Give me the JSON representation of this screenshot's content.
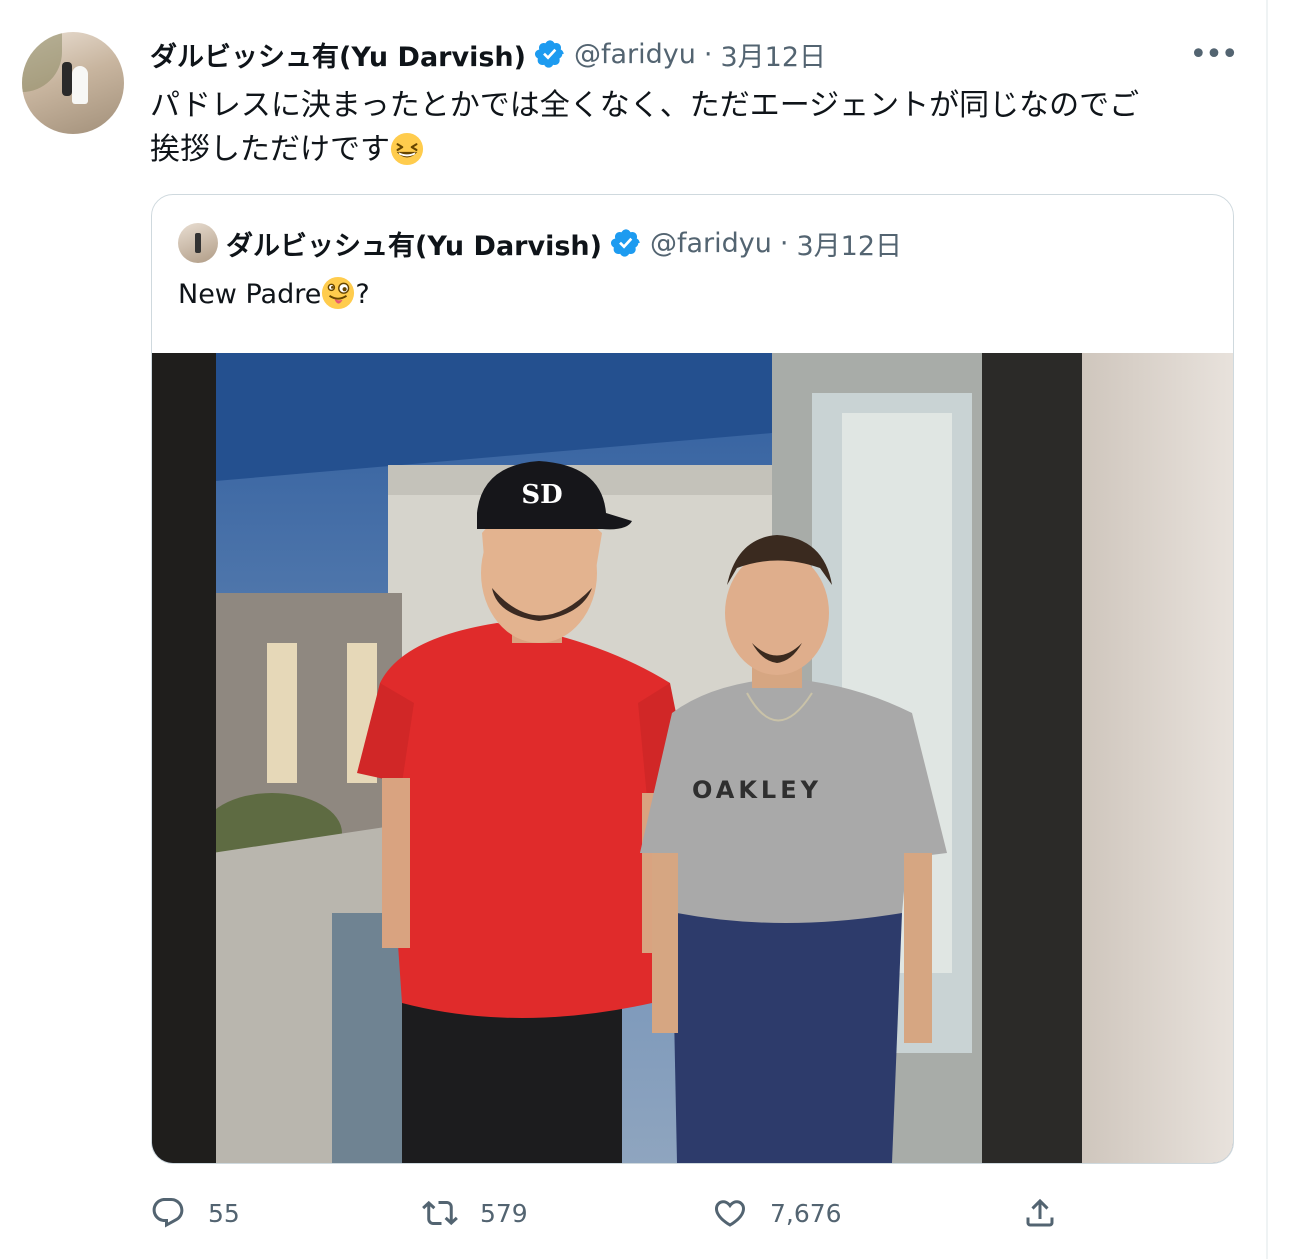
{
  "tweet": {
    "author_name": "ダルビッシュ有(Yu Darvish)",
    "handle": "@faridyu",
    "separator": "·",
    "date": "3月12日",
    "more_label": "•••",
    "text_part1": "パドレスに決まったとかでは全くなく、ただエージェントが同じなのでご",
    "text_part2": "挨拶しただけです",
    "text_emoji": "grinning-squinting-face-emoji"
  },
  "quoted_tweet": {
    "author_name": "ダルビッシュ有(Yu Darvish)",
    "handle": "@faridyu",
    "separator": "·",
    "date": "3月12日",
    "text": "New Padre",
    "text_emoji": "winking-face-with-tongue-emoji",
    "text_suffix": "?",
    "photo_cap_logo": "SD",
    "photo_shirt_logo": "OAKLEY"
  },
  "actions": {
    "replies": "55",
    "retweets": "579",
    "likes": "7,676"
  },
  "colors": {
    "verified_blue": "#1d9bf0",
    "secondary_text": "#536471",
    "border": "#cfd9de"
  }
}
